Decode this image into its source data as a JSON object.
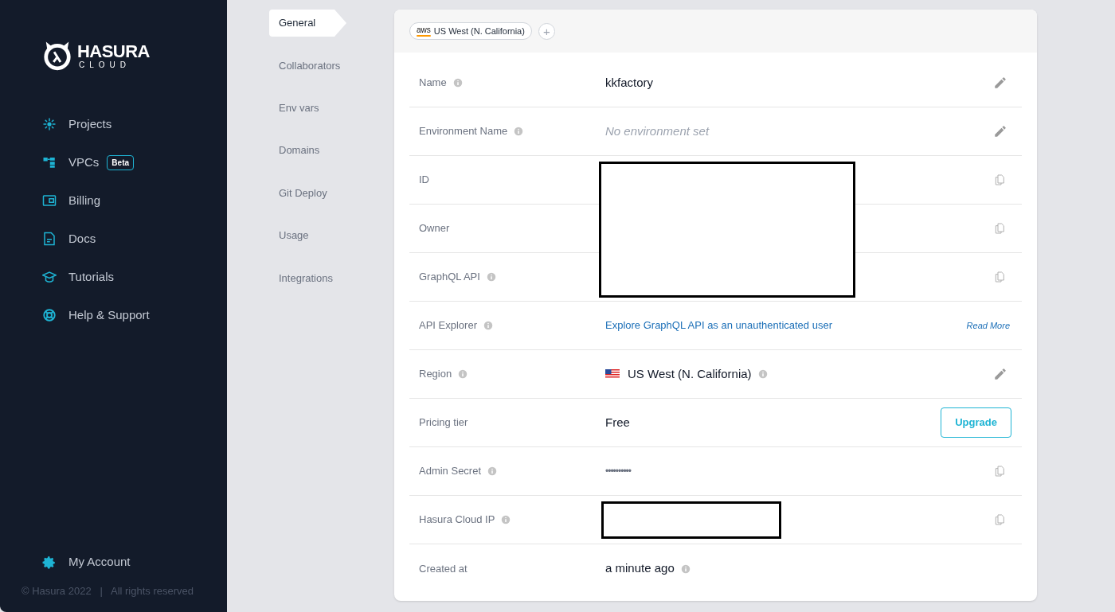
{
  "sidebar": {
    "logo": {
      "title": "HASURA",
      "subtitle": "CLOUD"
    },
    "items": [
      {
        "label": "Projects"
      },
      {
        "label": "VPCs",
        "badge": "Beta"
      },
      {
        "label": "Billing"
      },
      {
        "label": "Docs"
      },
      {
        "label": "Tutorials"
      },
      {
        "label": "Help & Support"
      }
    ],
    "account": "My Account",
    "footer": "© Hasura 2022   |   All rights reserved"
  },
  "subnav": [
    {
      "label": "General",
      "selected": true
    },
    {
      "label": "Collaborators",
      "selected": false
    },
    {
      "label": "Env vars",
      "selected": false
    },
    {
      "label": "Domains",
      "selected": false
    },
    {
      "label": "Git Deploy",
      "selected": false
    },
    {
      "label": "Usage",
      "selected": false
    },
    {
      "label": "Integrations",
      "selected": false
    }
  ],
  "region_chip": {
    "provider": "aws",
    "label": "US West (N. California)",
    "add": "+"
  },
  "rows": [
    {
      "label": "Name",
      "info": true,
      "kind": "text",
      "value": "kkfactory",
      "action": {
        "kind": "edit"
      }
    },
    {
      "label": "Environment Name",
      "info": true,
      "kind": "empty_note",
      "value": "No environment set",
      "action": {
        "kind": "edit"
      }
    },
    {
      "label": "ID",
      "info": false,
      "kind": "redacted",
      "action": {
        "kind": "copy"
      }
    },
    {
      "label": "Owner",
      "info": false,
      "kind": "redacted",
      "action": {
        "kind": "copy"
      }
    },
    {
      "label": "GraphQL API",
      "info": true,
      "kind": "redacted",
      "action": {
        "kind": "copy"
      }
    },
    {
      "label": "API Explorer",
      "info": true,
      "kind": "link",
      "value": "Explore GraphQL API as an unauthenticated user",
      "action": {
        "kind": "link",
        "label": "Read More"
      }
    },
    {
      "label": "Region",
      "info": true,
      "kind": "region",
      "value": "US West (N. California)",
      "action": {
        "kind": "edit"
      }
    },
    {
      "label": "Pricing tier",
      "info": false,
      "kind": "text",
      "value": "Free",
      "action": {
        "kind": "button",
        "label": "Upgrade"
      }
    },
    {
      "label": "Admin Secret",
      "info": true,
      "kind": "secret",
      "value": "••••••••••",
      "action": {
        "kind": "copy"
      }
    },
    {
      "label": "Hasura Cloud IP",
      "info": true,
      "kind": "redacted_inline",
      "action": {
        "kind": "copy"
      }
    },
    {
      "label": "Created at",
      "info": false,
      "kind": "text",
      "value": "a minute ago",
      "value_info": true
    }
  ]
}
